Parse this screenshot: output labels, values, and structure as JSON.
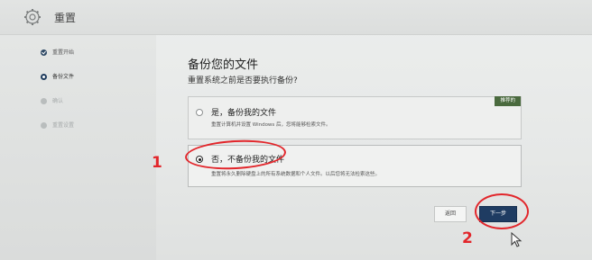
{
  "app": {
    "title": "重置"
  },
  "steps": [
    {
      "label": "重置开始",
      "state": "done"
    },
    {
      "label": "备份文件",
      "state": "current"
    },
    {
      "label": "确认",
      "state": "pending"
    },
    {
      "label": "重置设置",
      "state": "pending"
    }
  ],
  "main": {
    "heading": "备份您的文件",
    "subheading": "重置系统之前是否要执行备份?",
    "options": [
      {
        "title": "是，备份我的文件",
        "description": "重置计算机并设置 Windows 后，您将能够检索文件。",
        "badge": "推荐的",
        "selected": false
      },
      {
        "title": "否，不备份我的文件",
        "description": "重置将永久删除硬盘上的所有系统数据和个人文件。以后您将无法检索这些。",
        "selected": true
      }
    ],
    "buttons": {
      "back": "返回",
      "next": "下一步"
    }
  },
  "annotations": {
    "one": "1",
    "two": "2"
  },
  "colors": {
    "accent": "#1f3c62",
    "badge": "#4a6a3e",
    "annotation": "#e2262b"
  }
}
